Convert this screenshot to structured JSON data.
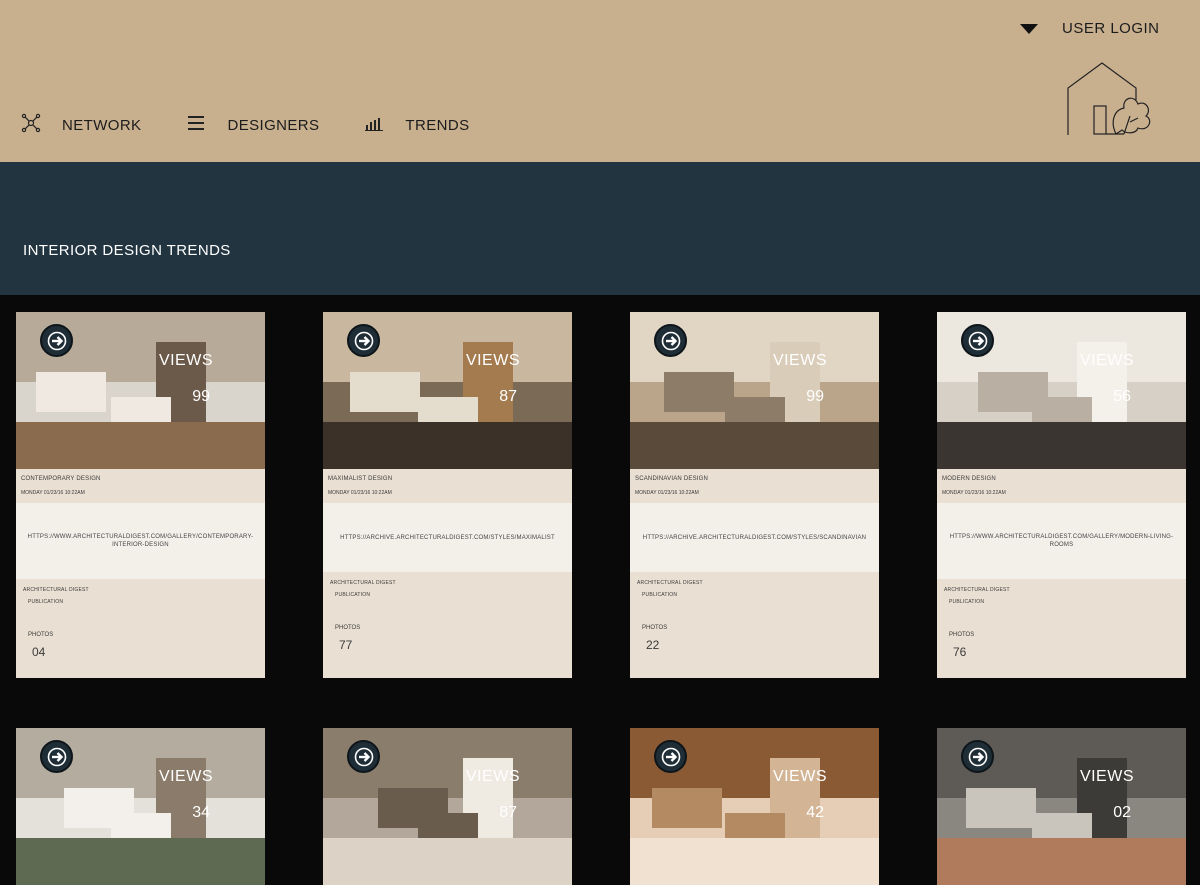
{
  "header": {
    "login_label": "USER LOGIN",
    "nav": [
      {
        "label": "NETWORK",
        "icon": "network-icon"
      },
      {
        "label": "DESIGNERS",
        "icon": "menu-icon"
      },
      {
        "label": "TRENDS",
        "icon": "bar-chart-icon"
      }
    ],
    "logo_icon": "house-plant-logo"
  },
  "banner": {
    "title": "INTERIOR DESIGN TRENDS"
  },
  "colors": {
    "header_bg": "#c8b08f",
    "banner_bg": "#213440",
    "page_bg": "#0a0909",
    "card_bg": "#e9dfd2",
    "url_bg": "#f2f0e9"
  },
  "cards": [
    {
      "views_label": "VIEWS",
      "views": "99",
      "style": "CONTEMPORARY DESIGN",
      "date": "MONDAY 01/23/16 10:22AM",
      "url": "HTTPS://WWW.ARCHITECTURALDIGEST.COM/GALLERY/CONTEMPORARY-INTERIOR-DESIGN",
      "publication": "ARCHITECTURAL DIGEST",
      "publication_label": "PUBLICATION",
      "photos_label": "PHOTOS",
      "photos": "04"
    },
    {
      "views_label": "VIEWS",
      "views": "87",
      "style": "MAXIMALIST DESIGN",
      "date": "MONDAY 01/23/16 10:22AM",
      "url": "HTTPS://ARCHIVE.ARCHITECTURALDIGEST.COM/STYLES/MAXIMALIST",
      "publication": "ARCHITECTURAL DIGEST",
      "publication_label": "PUBLICATION",
      "photos_label": "PHOTOS",
      "photos": "77"
    },
    {
      "views_label": "VIEWS",
      "views": "99",
      "style": "SCANDINAVIAN DESIGN",
      "date": "MONDAY 01/23/16 10:22AM",
      "url": "HTTPS://ARCHIVE.ARCHITECTURALDIGEST.COM/STYLES/SCANDINAVIAN",
      "publication": "ARCHITECTURAL DIGEST",
      "publication_label": "PUBLICATION",
      "photos_label": "PHOTOS",
      "photos": "22"
    },
    {
      "views_label": "VIEWS",
      "views": "56",
      "style": "MODERN DESIGN",
      "date": "MONDAY 01/23/16 10:22AM",
      "url": "HTTPS://WWW.ARCHITECTURALDIGEST.COM/GALLERY/MODERN-LIVING-ROOMS",
      "publication": "ARCHITECTURAL DIGEST",
      "publication_label": "PUBLICATION",
      "photos_label": "PHOTOS",
      "photos": "76"
    },
    {
      "views_label": "VIEWS",
      "views": "34"
    },
    {
      "views_label": "VIEWS",
      "views": "87"
    },
    {
      "views_label": "VIEWS",
      "views": "42"
    },
    {
      "views_label": "VIEWS",
      "views": "02"
    }
  ]
}
